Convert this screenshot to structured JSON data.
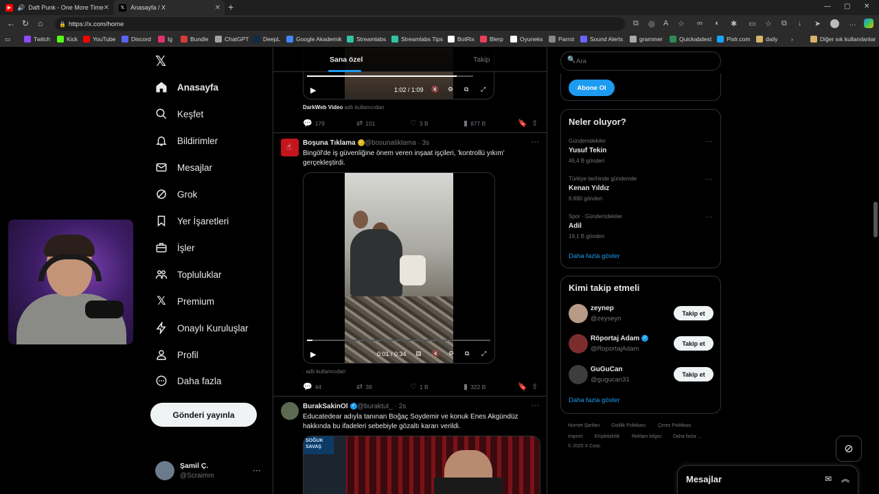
{
  "browser": {
    "tabs": [
      {
        "title": "Daft Punk - One More Time",
        "icon": "youtube-icon",
        "color": "#ff0000"
      },
      {
        "title": "Anasayfa / X",
        "icon": "x-logo-icon",
        "color": "#000000"
      }
    ],
    "url": "https://x.com/home",
    "bookmarks": [
      {
        "label": "Twitch",
        "color": "#9146ff"
      },
      {
        "label": "Kick",
        "color": "#53fc18"
      },
      {
        "label": "YouTube",
        "color": "#ff0000"
      },
      {
        "label": "Discord",
        "color": "#5865f2"
      },
      {
        "label": "Ig",
        "color": "#e1306c"
      },
      {
        "label": "Bundle",
        "color": "#d63b3b"
      },
      {
        "label": "ChatGPT",
        "color": "#9ea3a8"
      },
      {
        "label": "DeepL",
        "color": "#0f2b46"
      },
      {
        "label": "Google Akademik",
        "color": "#4285f4"
      },
      {
        "label": "Streamlabs",
        "color": "#31c3a2"
      },
      {
        "label": "Streamlabs Tips",
        "color": "#31c3a2"
      },
      {
        "label": "BotRix",
        "color": "#ffffff"
      },
      {
        "label": "Blerp",
        "color": "#e8405a"
      },
      {
        "label": "Oyuneks",
        "color": "#ffffff"
      },
      {
        "label": "Parrot",
        "color": "#888888"
      },
      {
        "label": "Sound Alerts",
        "color": "#6c63ff"
      },
      {
        "label": "grammer",
        "color": "#aaaaaa"
      },
      {
        "label": "Quickabdest",
        "color": "#2e8b57"
      },
      {
        "label": "Pixlr.com",
        "color": "#1aa3ff"
      },
      {
        "label": "daily",
        "color": "#d8b36a"
      }
    ],
    "other_bookmarks": "Diğer sık kullanılanlar"
  },
  "nav": {
    "items": [
      {
        "label": "Anasayfa",
        "icon": "home-icon"
      },
      {
        "label": "Keşfet",
        "icon": "search-icon"
      },
      {
        "label": "Bildirimler",
        "icon": "bell-icon"
      },
      {
        "label": "Mesajlar",
        "icon": "mail-icon"
      },
      {
        "label": "Grok",
        "icon": "grok-icon"
      },
      {
        "label": "Yer İşaretleri",
        "icon": "bookmark-icon"
      },
      {
        "label": "İşler",
        "icon": "briefcase-icon"
      },
      {
        "label": "Topluluklar",
        "icon": "communities-icon"
      },
      {
        "label": "Premium",
        "icon": "x-logo-icon"
      },
      {
        "label": "Onaylı Kuruluşlar",
        "icon": "lightning-icon"
      },
      {
        "label": "Profil",
        "icon": "person-icon"
      },
      {
        "label": "Daha fazla",
        "icon": "more-circle-icon"
      }
    ],
    "post_button": "Gönderi yayınla",
    "account": {
      "name": "Şamil Ç.",
      "handle": "@Scraimm"
    }
  },
  "feed": {
    "tabs": [
      "Sana özel",
      "Takip"
    ],
    "tweet0": {
      "video_time": "1:02 / 1:09",
      "video_progress": 0.9,
      "source_name": "DarkWeb Video",
      "source_suffix": "adlı kullanıcıdan",
      "replies": "179",
      "reposts": "101",
      "likes": "3 B",
      "views": "877 B"
    },
    "tweet1": {
      "name": "Boşuna Tıklama",
      "handle": "@bosunatiklama",
      "time": "· 3s",
      "text": "Bingöl'de iş güvenliğine önem veren inşaat işçileri, 'kontrollü yıkım' gerçekleştirdi.",
      "video_time": "0:01 / 0:34",
      "video_progress": 0.03,
      "source_prefix": ".",
      "source_suffix": "adlı kullanıcıdan",
      "replies": "44",
      "reposts": "38",
      "likes": "1 B",
      "views": "322 B"
    },
    "tweet2": {
      "name": "BurakSakinOl",
      "handle": "@buraktut_",
      "time": "· 2s",
      "text": "Educatedear adıyla tanınan Boğaç Soydemir ve konuk Enes Akgündüz hakkında bu ifadeleri sebebiyle gözaltı kararı verildi.",
      "thumb_label": "SOĞUK SAVAŞ"
    }
  },
  "right": {
    "search_placeholder": "Ara",
    "subscribe": "Abone Ol",
    "trends_title": "Neler oluyor?",
    "trends": [
      {
        "context": "Gündemdekiler",
        "name": "Yusuf Tekin",
        "count": "46,4 B gönderi"
      },
      {
        "context": "Türkiye tarihinde gündemde",
        "name": "Kenan Yıldız",
        "count": "6.890 gönderi"
      },
      {
        "context": "Spor · Gündemdekiler",
        "name": "Adil",
        "count": "19,1 B gönderi"
      }
    ],
    "trends_more": "Daha fazla göster",
    "who_title": "Kimi takip etmeli",
    "who": [
      {
        "name": "zeynep",
        "handle": "@zeyseyn",
        "verified": false
      },
      {
        "name": "Röportaj Adam",
        "handle": "@RoportajAdam",
        "verified": true
      },
      {
        "name": "GuGuCan",
        "handle": "@gugucan31",
        "verified": false
      }
    ],
    "follow_label": "Takip et",
    "who_more": "Daha fazla göster",
    "footer": [
      "Hizmet Şartları",
      "Gizlilik Politikası",
      "Çerez Politikası",
      "Imprint",
      "Erişilebilirlik",
      "Reklam bilgisi",
      "Daha fazla ...",
      "© 2025 X Corp."
    ]
  },
  "messages_drawer": "Mesajlar"
}
